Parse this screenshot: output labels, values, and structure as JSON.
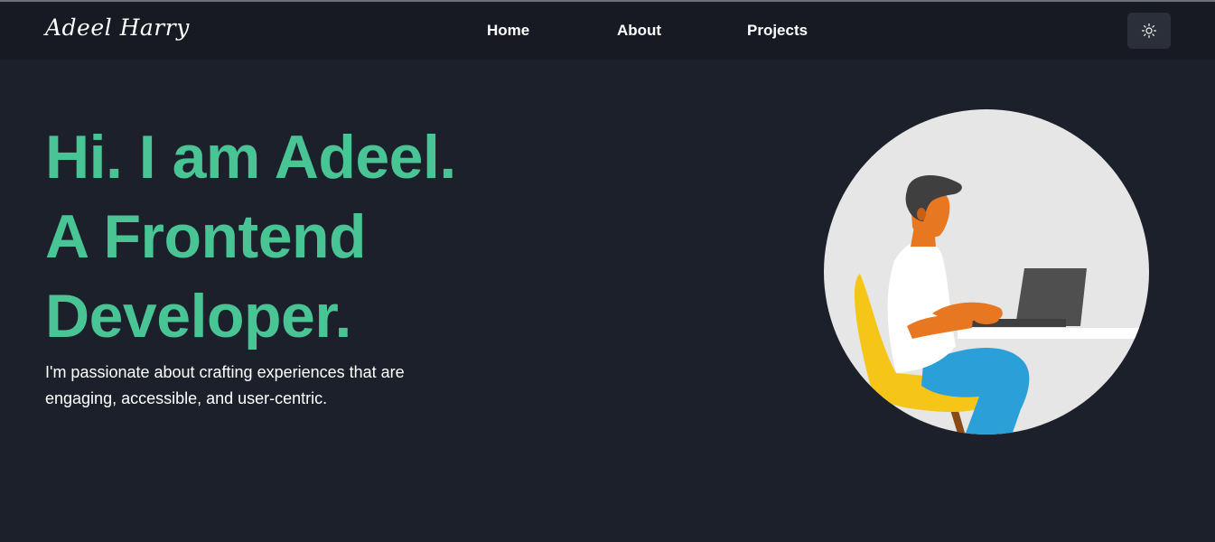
{
  "header": {
    "brand": "Adeel Harry",
    "nav": [
      {
        "label": "Home"
      },
      {
        "label": "About"
      },
      {
        "label": "Projects"
      }
    ],
    "theme_toggle_icon": "sun-icon"
  },
  "hero": {
    "heading_lines": [
      "Hi. I am Adeel.",
      "A Frontend",
      "Developer."
    ],
    "subtitle": "I'm passionate about crafting experiences that are engaging, accessible, and user-centric.",
    "illustration_icon": "person-at-laptop-illustration"
  },
  "colors": {
    "background": "#1c202b",
    "navbar": "#171a22",
    "accent": "#48c495",
    "text": "#ffffff",
    "toggle_bg": "#2b2f3a"
  }
}
